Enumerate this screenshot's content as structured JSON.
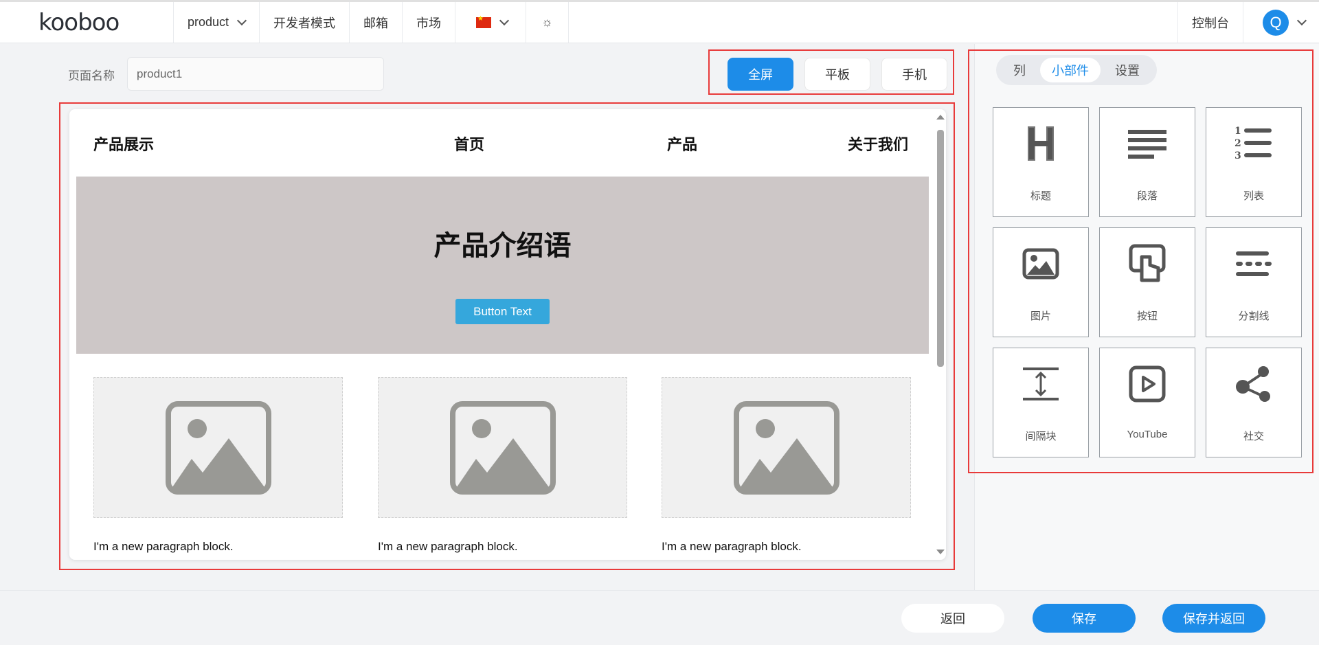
{
  "topbar": {
    "logo": "kooboo",
    "site_label": "product",
    "dev_mode": "开发者模式",
    "mail": "邮箱",
    "market": "市场",
    "console": "控制台",
    "avatar_initial": "Q"
  },
  "editor": {
    "page_name_label": "页面名称",
    "page_name_value": "product1",
    "devices": {
      "fullscreen": "全屏",
      "tablet": "平板",
      "mobile": "手机"
    },
    "preview": {
      "brand": "产品展示",
      "nav": [
        "首页",
        "产品",
        "关于我们"
      ],
      "hero_title": "产品介绍语",
      "hero_button": "Button Text",
      "paragraphs": [
        "I'm a new paragraph block.",
        "I'm a new paragraph block.",
        "I'm a new paragraph block."
      ]
    }
  },
  "panel": {
    "tabs": [
      "列",
      "小部件",
      "设置"
    ],
    "active_tab": "小部件",
    "widgets": [
      {
        "label": "标题",
        "icon": "heading-icon"
      },
      {
        "label": "段落",
        "icon": "paragraph-icon"
      },
      {
        "label": "列表",
        "icon": "list-icon"
      },
      {
        "label": "图片",
        "icon": "image-icon"
      },
      {
        "label": "按钮",
        "icon": "button-icon"
      },
      {
        "label": "分割线",
        "icon": "divider-icon"
      },
      {
        "label": "间隔块",
        "icon": "spacer-icon"
      },
      {
        "label": "YouTube",
        "icon": "youtube-icon"
      },
      {
        "label": "社交",
        "icon": "social-icon"
      }
    ]
  },
  "footer": {
    "back": "返回",
    "save": "保存",
    "save_back": "保存并返回"
  },
  "colors": {
    "accent": "#1d8ce8",
    "highlight": "#e83a3a",
    "hero_bg": "#cdc7c7",
    "hero_button": "#35a7dc"
  }
}
